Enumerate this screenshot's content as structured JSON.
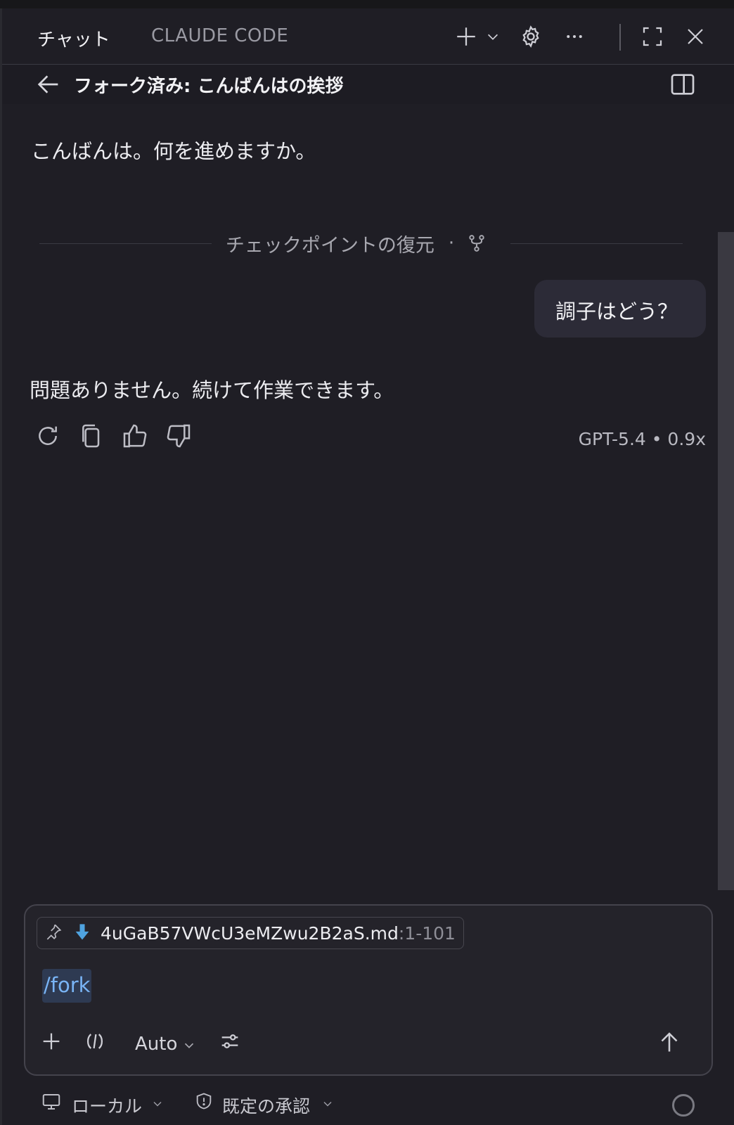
{
  "header": {
    "tab_chat": "チャット",
    "tab_claude_code": "CLAUDE CODE",
    "icons": [
      "plus-icon",
      "chevron-down-icon",
      "gear-icon",
      "ellipsis-icon",
      "maximize-icon",
      "close-icon"
    ]
  },
  "forkbar": {
    "title": "フォーク済み: こんばんはの挨拶"
  },
  "messages": {
    "assistant_1": "こんばんは。何を進めますか。",
    "checkpoint_label": "チェックポイントの復元",
    "checkpoint_sep": "·",
    "user_1": "調子はどう？",
    "assistant_2": "問題ありません。続けて作業できます。",
    "model_info": "GPT-5.4 • 0.9x"
  },
  "composer": {
    "attachment_name": "4uGaB57VWcU3eMZwu2B2aS.md",
    "attachment_range": ":1-101",
    "input_value": "/fork",
    "mode_label": "Auto"
  },
  "footer": {
    "location_label": "ローカル",
    "approval_label": "既定の承認"
  },
  "colors": {
    "background": "#1f1e25",
    "bubble": "#2c2b37",
    "accent_blue": "#79b4f5",
    "attachment_icon": "#4fa3e0"
  }
}
